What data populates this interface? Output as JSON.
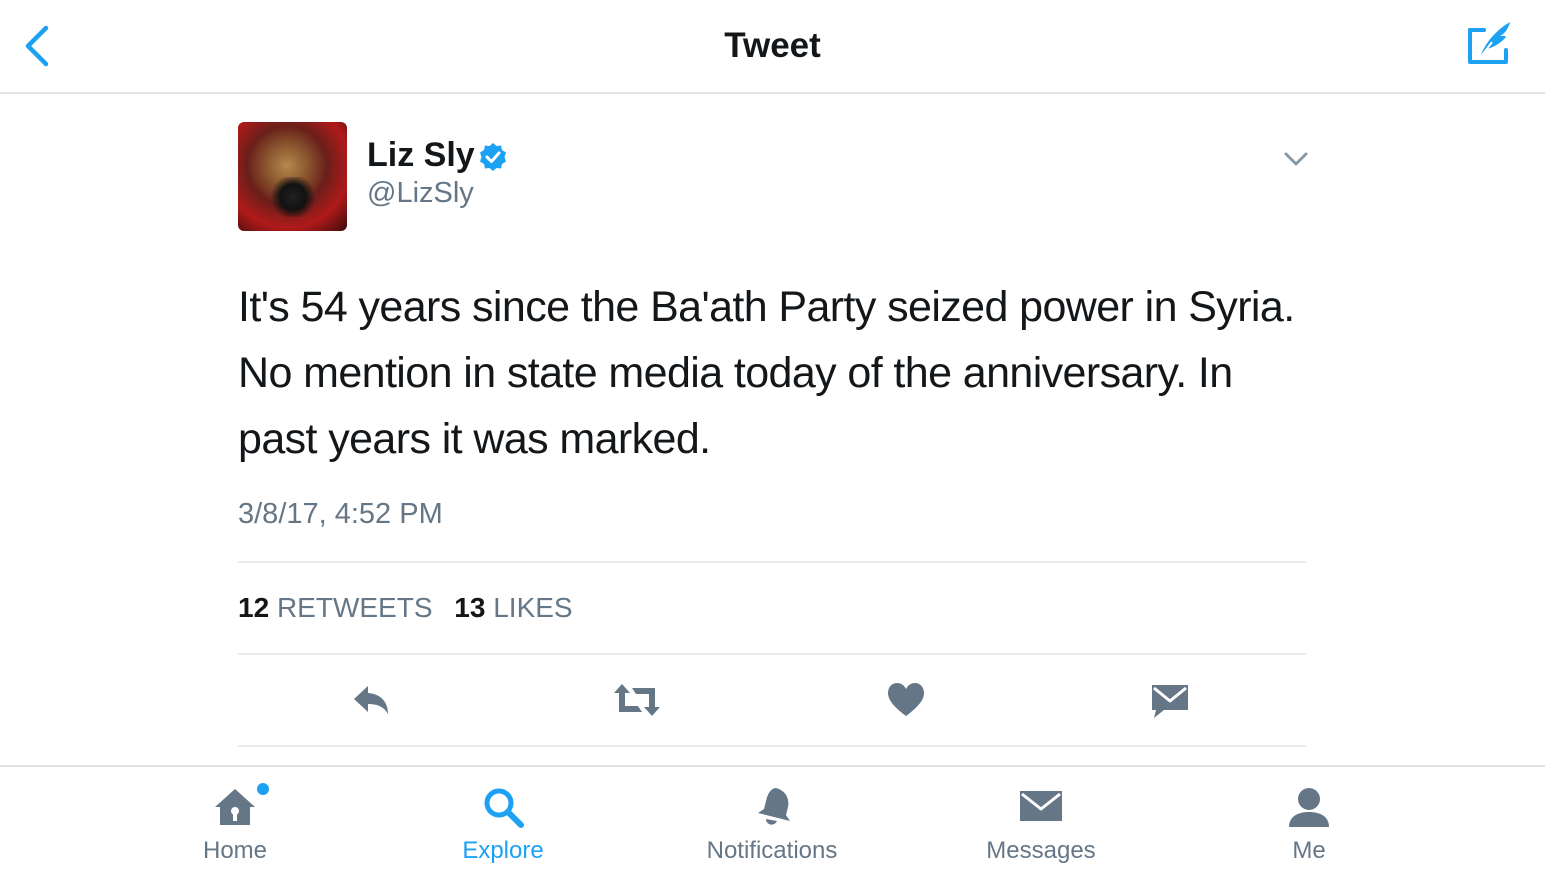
{
  "header": {
    "title": "Tweet"
  },
  "tweet": {
    "author_name": "Liz Sly",
    "handle": "@LizSly",
    "text": "It's 54 years since the Ba'ath Party seized power in Syria. No mention in state media today of the anniversary. In past years it was marked.",
    "timestamp": "3/8/17, 4:52 PM",
    "stats": {
      "retweets_count": "12",
      "retweets_label": "RETWEETS",
      "likes_count": "13",
      "likes_label": "LIKES"
    }
  },
  "tabbar": {
    "tabs": [
      {
        "label": "Home",
        "icon": "home-icon"
      },
      {
        "label": "Explore",
        "icon": "search-icon"
      },
      {
        "label": "Notifications",
        "icon": "bell-icon"
      },
      {
        "label": "Messages",
        "icon": "envelope-icon"
      },
      {
        "label": "Me",
        "icon": "person-icon"
      }
    ],
    "active": "Explore"
  },
  "colors": {
    "accent": "#1da1f2",
    "text": "#14171a",
    "secondary": "#657786",
    "divider": "#e6ecf0"
  }
}
